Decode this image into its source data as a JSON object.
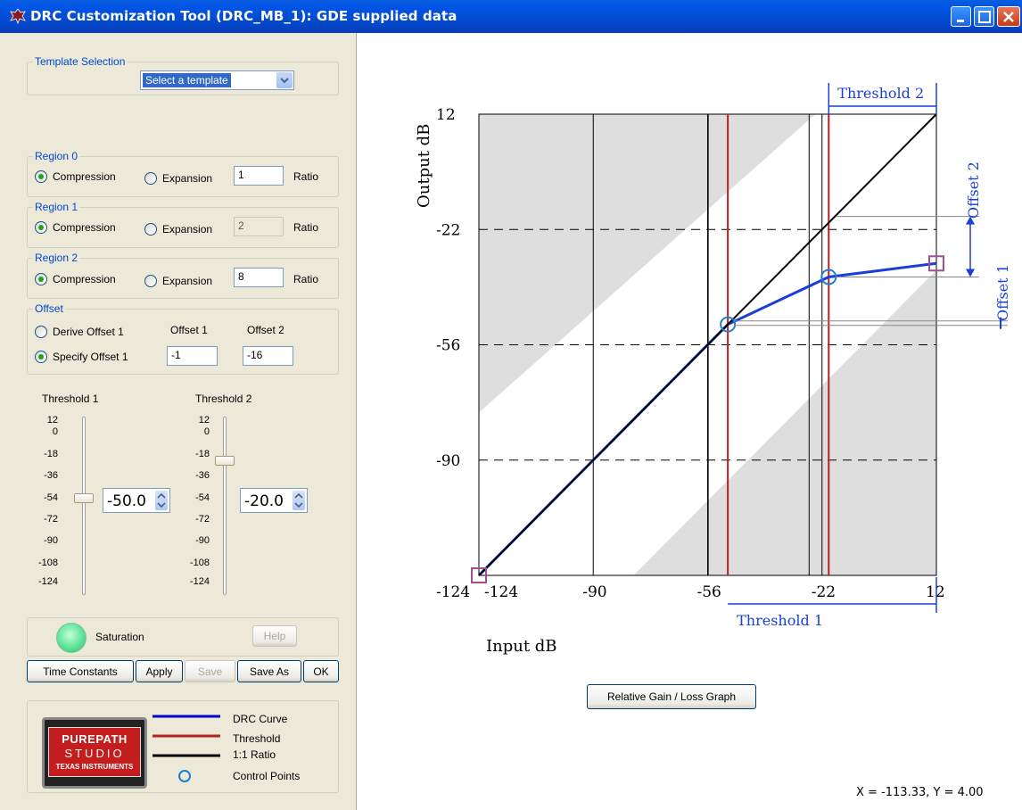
{
  "window": {
    "title": "DRC Customization Tool (DRC_MB_1):  GDE supplied data"
  },
  "template": {
    "legend": "Template Selection",
    "selected": "Select a template"
  },
  "regions": [
    {
      "legend": "Region 0",
      "compression_label": "Compression",
      "expansion_label": "Expansion",
      "mode": "compression",
      "ratio": "1",
      "ratio_label": "Ratio",
      "ratio_enabled": true
    },
    {
      "legend": "Region 1",
      "compression_label": "Compression",
      "expansion_label": "Expansion",
      "mode": "compression",
      "ratio": "2",
      "ratio_label": "Ratio",
      "ratio_enabled": false
    },
    {
      "legend": "Region 2",
      "compression_label": "Compression",
      "expansion_label": "Expansion",
      "mode": "compression",
      "ratio": "8",
      "ratio_label": "Ratio",
      "ratio_enabled": true
    }
  ],
  "offset": {
    "legend": "Offset",
    "derive_label": "Derive Offset 1",
    "specify_label": "Specify Offset 1",
    "mode": "specify",
    "offset1_label": "Offset 1",
    "offset2_label": "Offset 2",
    "offset1_value": "-1",
    "offset2_value": "-16"
  },
  "thresholds": {
    "t1_label": "Threshold 1",
    "t2_label": "Threshold 2",
    "scale": [
      "12",
      "0",
      "-18",
      "-36",
      "-54",
      "-72",
      "-90",
      "-108",
      "-124"
    ],
    "t1_value": "-50.0",
    "t2_value": "-20.0"
  },
  "saturation": {
    "label": "Saturation",
    "help": "Help"
  },
  "buttons": {
    "time_constants": "Time Constants",
    "apply": "Apply",
    "save": "Save",
    "save_as": "Save As",
    "ok": "OK"
  },
  "legend_box": {
    "items": [
      "DRC Curve",
      "Threshold",
      "1:1 Ratio",
      "Control Points"
    ],
    "colors": [
      "#0000c8",
      "#b22222",
      "#000000",
      "#1e7fd0"
    ]
  },
  "logo": {
    "line1": "PUREPATH",
    "line2": "STUDIO",
    "line3": "TEXAS INSTRUMENTS"
  },
  "relative_gain_button": "Relative Gain / Loss Graph",
  "coord_readout": "X = -113.33, Y = 4.00",
  "chart_data": {
    "type": "line",
    "xlabel": "Input dB",
    "ylabel": "Output dB",
    "xticks": [
      "-124",
      "-90",
      "-56",
      "-22",
      "12"
    ],
    "yticks": [
      "12",
      "-22",
      "-56",
      "-90",
      "-124"
    ],
    "xlim": [
      -124,
      12
    ],
    "ylim": [
      -124,
      12
    ],
    "series": [
      {
        "name": "DRC Curve",
        "color": "#1a3fd8",
        "x": [
          -124,
          -50,
          -20,
          12
        ],
        "y": [
          -124,
          -50,
          -36,
          -32
        ]
      },
      {
        "name": "1:1 Ratio",
        "color": "#000000",
        "x": [
          -124,
          12
        ],
        "y": [
          -124,
          12
        ]
      }
    ],
    "thresholds": [
      -50,
      -20
    ],
    "threshold_labels": [
      "Threshold 1",
      "Threshold 2"
    ],
    "offset_labels": [
      "Offset 1",
      "Offset 2"
    ],
    "control_points": [
      {
        "x": -50,
        "y": -50
      },
      {
        "x": -20,
        "y": -36
      }
    ],
    "end_points": [
      {
        "x": -124,
        "y": -124
      },
      {
        "x": 12,
        "y": -32
      }
    ]
  }
}
